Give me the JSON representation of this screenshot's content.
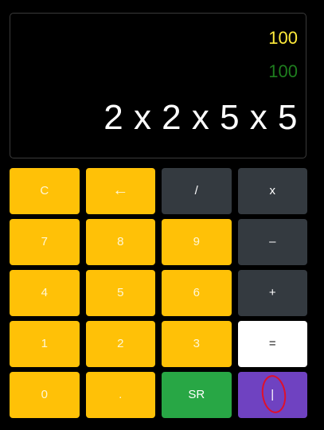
{
  "display": {
    "result_yellow": "100",
    "result_green": "100",
    "expression": "2 x 2 x 5 x 5"
  },
  "keys": [
    {
      "label": "C",
      "name": "clear-button",
      "style": "yellow"
    },
    {
      "label": "←",
      "name": "backspace-button",
      "style": "yellow"
    },
    {
      "label": "/",
      "name": "divide-button",
      "style": "dark"
    },
    {
      "label": "x",
      "name": "multiply-button",
      "style": "dark"
    },
    {
      "label": "7",
      "name": "digit-7-button",
      "style": "yellow"
    },
    {
      "label": "8",
      "name": "digit-8-button",
      "style": "yellow"
    },
    {
      "label": "9",
      "name": "digit-9-button",
      "style": "yellow"
    },
    {
      "label": "–",
      "name": "subtract-button",
      "style": "dark"
    },
    {
      "label": "4",
      "name": "digit-4-button",
      "style": "yellow"
    },
    {
      "label": "5",
      "name": "digit-5-button",
      "style": "yellow"
    },
    {
      "label": "6",
      "name": "digit-6-button",
      "style": "yellow"
    },
    {
      "label": "+",
      "name": "add-button",
      "style": "dark"
    },
    {
      "label": "1",
      "name": "digit-1-button",
      "style": "yellow"
    },
    {
      "label": "2",
      "name": "digit-2-button",
      "style": "yellow"
    },
    {
      "label": "3",
      "name": "digit-3-button",
      "style": "yellow"
    },
    {
      "label": "=",
      "name": "equals-button",
      "style": "white"
    },
    {
      "label": "0",
      "name": "digit-0-button",
      "style": "yellow"
    },
    {
      "label": ".",
      "name": "decimal-button",
      "style": "yellow"
    },
    {
      "label": "SR",
      "name": "square-root-button",
      "style": "green"
    },
    {
      "label": "|",
      "name": "pipe-button",
      "style": "purple"
    }
  ],
  "colors": {
    "background": "#000000",
    "yellow_key": "#ffc107",
    "dark_key": "#343a40",
    "white_key": "#ffffff",
    "green_key": "#28a745",
    "purple_key": "#6f42c1",
    "display_yellow_text": "#ffeb3b",
    "display_green_text": "#1e7d1e",
    "annotation_circle": "#e0102a"
  }
}
